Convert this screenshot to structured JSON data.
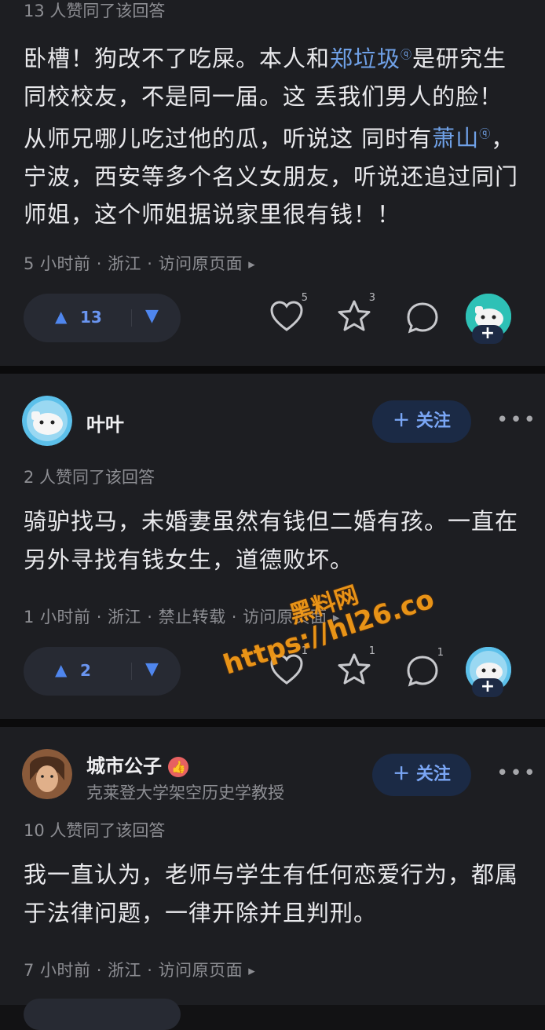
{
  "answers": [
    {
      "likes_text": "13 人赞同了该回答",
      "body": {
        "p1": "卧槽！狗改不了吃屎。本人和",
        "link1": "郑垃圾",
        "p2": "是研究生同校校友，不是同一届。这 丢我们男人的脸！从师兄哪儿吃过他的瓜，听说这 同时有",
        "link2": "萧山",
        "p3": "，宁波，西安等多个名义女朋友，听说还追过同门师姐，这个师姐据说家里很有钱！！"
      },
      "meta": "5 小时前 · 浙江 · 访问原页面",
      "votes": "13",
      "like_count": "5",
      "star_count": "3"
    },
    {
      "username": "叶叶",
      "follow_label": "＋ 关注",
      "likes_text": "2 人赞同了该回答",
      "body": "骑驴找马，未婚妻虽然有钱但二婚有孩。一直在另外寻找有钱女生，道德败坏。",
      "meta": "1 小时前 · 浙江 · 禁止转载 · 访问原页面",
      "votes": "2",
      "like_count": "1",
      "star_count": "1",
      "comment_count": "1"
    },
    {
      "username": "城市公子",
      "subtitle": "克莱登大学架空历史学教授",
      "follow_label": "＋ 关注",
      "likes_text": "10 人赞同了该回答",
      "body": "我一直认为，老师与学生有任何恋爱行为，都属于法律问题，一律开除并且判刑。",
      "meta": "7 小时前 · 浙江 · 访问原页面"
    }
  ],
  "watermark": {
    "line1": "黑料网",
    "line2": "https://hl26.co"
  },
  "colors": {
    "background": "#1d1e22",
    "link": "#6fa0e6",
    "accent": "#4f86ee",
    "watermark": "#f39a17"
  }
}
